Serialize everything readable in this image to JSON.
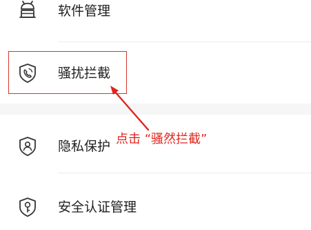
{
  "menu": {
    "items": [
      {
        "id": "software",
        "label": "软件管理",
        "icon": "android-robot-icon"
      },
      {
        "id": "harass",
        "label": "骚扰拦截",
        "icon": "shield-call-icon"
      },
      {
        "id": "privacy",
        "label": "隐私保护",
        "icon": "shield-user-icon"
      },
      {
        "id": "security",
        "label": "安全认证管理",
        "icon": "shield-key-icon"
      }
    ]
  },
  "annotation": {
    "callout_text": "点击 “骚然拦截”",
    "color": "#e0241b"
  }
}
